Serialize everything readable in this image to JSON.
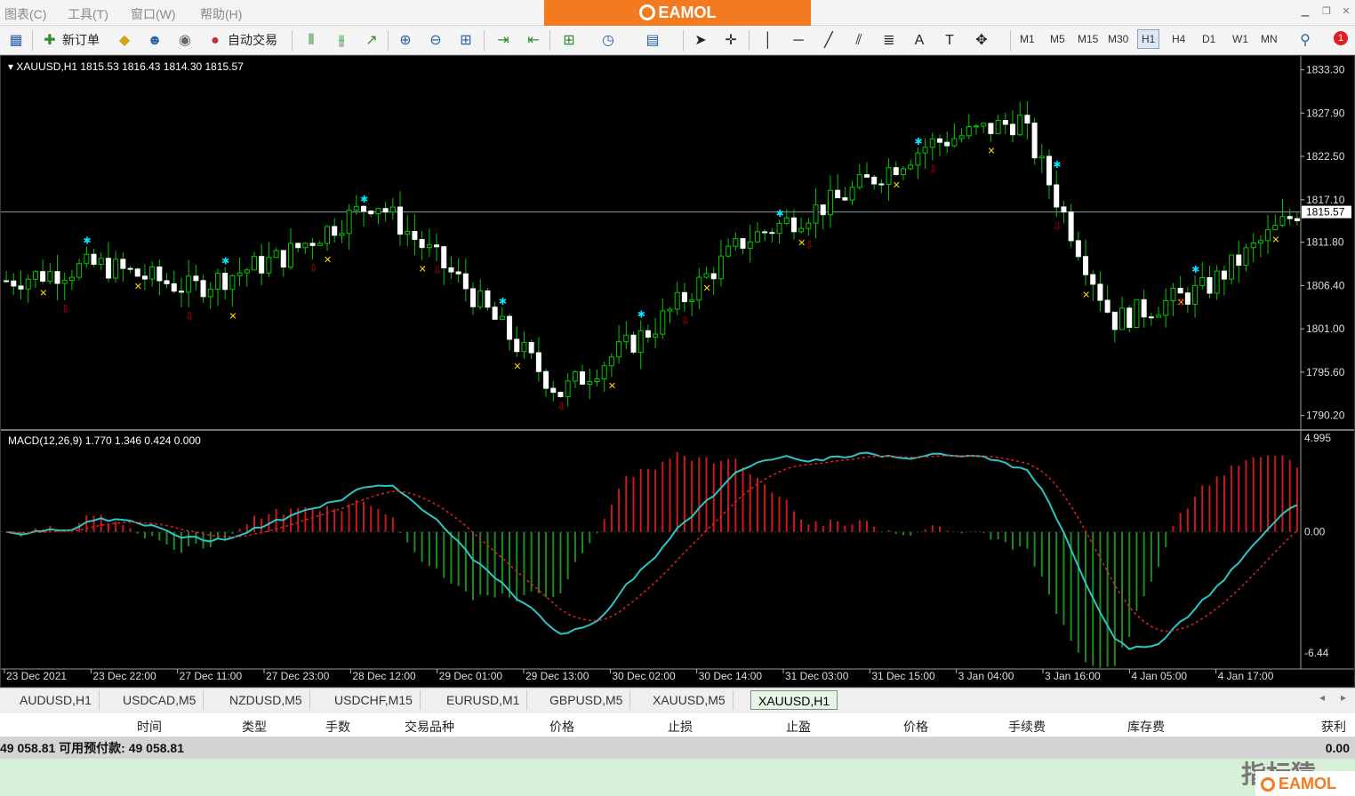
{
  "menu": {
    "items": [
      "图表(C)",
      "工具(T)",
      "窗口(W)",
      "帮助(H)"
    ]
  },
  "brand": {
    "name": "EAMOL",
    "color": "#f47a1f"
  },
  "toolbar": {
    "new_order": "新订单",
    "auto_trade": "自动交易",
    "timeframes": [
      "M1",
      "M5",
      "M15",
      "M30",
      "H1",
      "H4",
      "D1",
      "W1",
      "MN"
    ],
    "active_timeframe": "H1",
    "alert_count": "1"
  },
  "chart": {
    "header": "XAUUSD,H1  1815.53 1816.43 1814.30 1815.57",
    "price_ticks": [
      "1833.30",
      "1827.90",
      "1822.50",
      "1817.10",
      "1811.80",
      "1806.40",
      "1801.00",
      "1795.60",
      "1790.20"
    ],
    "current_price": "1815.57",
    "macd_header": "MACD(12,26,9) 1.770 1.346 0.424 0.000",
    "macd_ticks": [
      "4.995",
      "0.00",
      "-6.44"
    ],
    "time_ticks": [
      "23 Dec 2021",
      "23 Dec 22:00",
      "27 Dec 11:00",
      "27 Dec 23:00",
      "28 Dec 12:00",
      "29 Dec 01:00",
      "29 Dec 13:00",
      "30 Dec 02:00",
      "30 Dec 14:00",
      "31 Dec 03:00",
      "31 Dec 15:00",
      "3 Jan 04:00",
      "3 Jan 16:00",
      "4 Jan 05:00",
      "4 Jan 17:00"
    ]
  },
  "chart_data": {
    "type": "line",
    "title": "XAUUSD,H1",
    "x": [
      "23 Dec 2021",
      "23 Dec 22:00",
      "27 Dec 11:00",
      "27 Dec 23:00",
      "28 Dec 12:00",
      "29 Dec 01:00",
      "29 Dec 13:00",
      "30 Dec 02:00",
      "30 Dec 14:00",
      "31 Dec 03:00",
      "31 Dec 15:00",
      "3 Jan 04:00",
      "3 Jan 16:00",
      "4 Jan 05:00",
      "4 Jan 17:00"
    ],
    "series": [
      {
        "name": "",
        "values": [
          1807,
          1809,
          1806,
          1810,
          1817,
          1806,
          1793,
          1801,
          1812,
          1817,
          1824,
          1827,
          1802,
          1806,
          1815.6
        ],
        "color": "#00c000"
      }
    ],
    "ylim": [
      1788.5,
      1834.8
    ],
    "macd": {
      "name": "MACD(12,26,9)",
      "main": 1.77,
      "signal": 1.346,
      "histogram": 0.424,
      "ylim": [
        -6.44,
        4.995
      ]
    },
    "grid": false
  },
  "tabs": [
    "AUDUSD,H1",
    "USDCAD,M5",
    "NZDUSD,M5",
    "USDCHF,M15",
    "EURUSD,M1",
    "GBPUSD,M5",
    "XAUUSD,M5",
    "XAUUSD,H1"
  ],
  "active_tab": "XAUUSD,H1",
  "terminal": {
    "columns": [
      "时间",
      "类型",
      "手数",
      "交易品种",
      "价格",
      "止损",
      "止盈",
      "价格",
      "手续费",
      "库存费",
      "获利"
    ],
    "balance_text": "49 058.81  可用预付款: 49 058.81",
    "profit": "0.00"
  },
  "watermark": "指标猿"
}
